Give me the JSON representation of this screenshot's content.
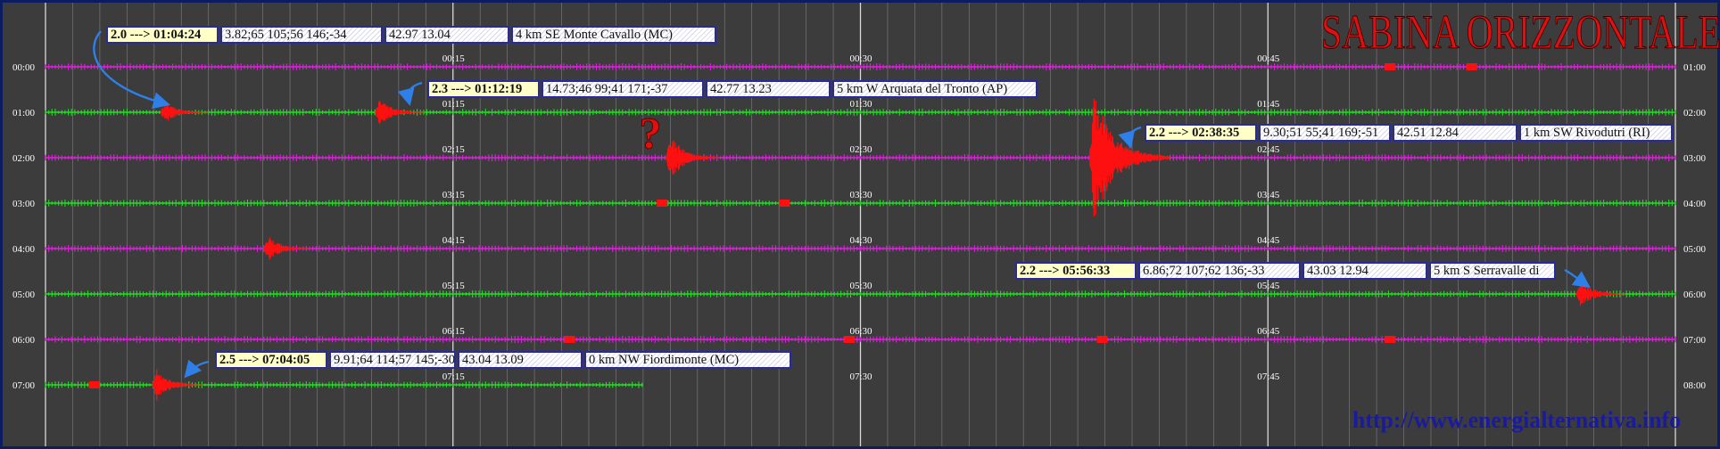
{
  "title": "SABINA ORIZZONTALE",
  "footer_url": "http://www.energialternativa.info",
  "left_times": [
    "00:00",
    "01:00",
    "02:00",
    "03:00",
    "04:00",
    "05:00",
    "06:00",
    "07:00"
  ],
  "right_times": [
    "01:00",
    "02:00",
    "03:00",
    "04:00",
    "05:00",
    "06:00",
    "07:00",
    "08:00"
  ],
  "quarter_marks": [
    [
      "00:15",
      "00:30",
      "00:45"
    ],
    [
      "01:15",
      "01:30",
      "01:45"
    ],
    [
      "02:15",
      "02:30",
      "02:45"
    ],
    [
      "03:15",
      "03:30",
      "03:45"
    ],
    [
      "04:15",
      "04:30",
      "04:45"
    ],
    [
      "05:15",
      "05:30",
      "05:45"
    ],
    [
      "06:15",
      "06:30",
      "06:45"
    ],
    [
      "07:15",
      "07:30",
      "07:45"
    ]
  ],
  "question_mark": "?",
  "colors": {
    "background": "#3c3c3c",
    "magenta": "#e020e0",
    "green": "#20e020",
    "quake": "#ff1010",
    "arrow": "#2f7fe8",
    "title": "#e01010",
    "url": "#1a1aa0"
  },
  "events": [
    {
      "mag": "2.0 ---> 01:04:24",
      "params": "3.82;65 105;56 146;-34",
      "coords": "42.97 13.04",
      "location": "4 km SE Monte Cavallo (MC)"
    },
    {
      "mag": "2.3 ---> 01:12:19",
      "params": "14.73;46 99;41 171;-37",
      "coords": "42.77 13.23",
      "location": "5 km W Arquata del Tronto (AP)"
    },
    {
      "mag": "2.2 ---> 02:38:35",
      "params": "9.30;51 55;41 169;-51",
      "coords": "42.51 12.84",
      "location": "1 km SW Rivodutri (RI)"
    },
    {
      "mag": "2.2 ---> 05:56:33",
      "params": "6.86;72 107;62 136;-33",
      "coords": "43.03 12.94",
      "location": "5 km S Serravalle di"
    },
    {
      "mag": "2.5 ---> 07:04:05",
      "params": "9.91;64 114;57 145;-30",
      "coords": "43.04 13.09",
      "location": "0 km NW Fiordimonte (MC)"
    }
  ],
  "chart_data": {
    "type": "line",
    "title": "SABINA ORIZZONTALE",
    "xlabel": "",
    "ylabel": "",
    "x_ticks_minutes": [
      "00",
      "15",
      "30",
      "45",
      "60"
    ],
    "rows": [
      {
        "start": "00:00",
        "end": "01:00",
        "color": "magenta"
      },
      {
        "start": "01:00",
        "end": "02:00",
        "color": "green"
      },
      {
        "start": "02:00",
        "end": "03:00",
        "color": "magenta"
      },
      {
        "start": "03:00",
        "end": "04:00",
        "color": "green"
      },
      {
        "start": "04:00",
        "end": "05:00",
        "color": "magenta"
      },
      {
        "start": "05:00",
        "end": "06:00",
        "color": "green"
      },
      {
        "start": "06:00",
        "end": "07:00",
        "color": "magenta"
      },
      {
        "start": "07:00",
        "end": "08:00",
        "color": "green"
      }
    ],
    "events": [
      {
        "row": 1,
        "minute": 4.4,
        "amplitude": 0.7
      },
      {
        "row": 1,
        "minute": 12.3,
        "amplitude": 0.9
      },
      {
        "row": 2,
        "minute": 23.0,
        "amplitude": 1.4
      },
      {
        "row": 2,
        "minute": 38.6,
        "amplitude": 4.0
      },
      {
        "row": 4,
        "minute": 8.2,
        "amplitude": 0.8
      },
      {
        "row": 5,
        "minute": 56.5,
        "amplitude": 0.9
      },
      {
        "row": 7,
        "minute": 4.1,
        "amplitude": 1.0
      }
    ]
  }
}
